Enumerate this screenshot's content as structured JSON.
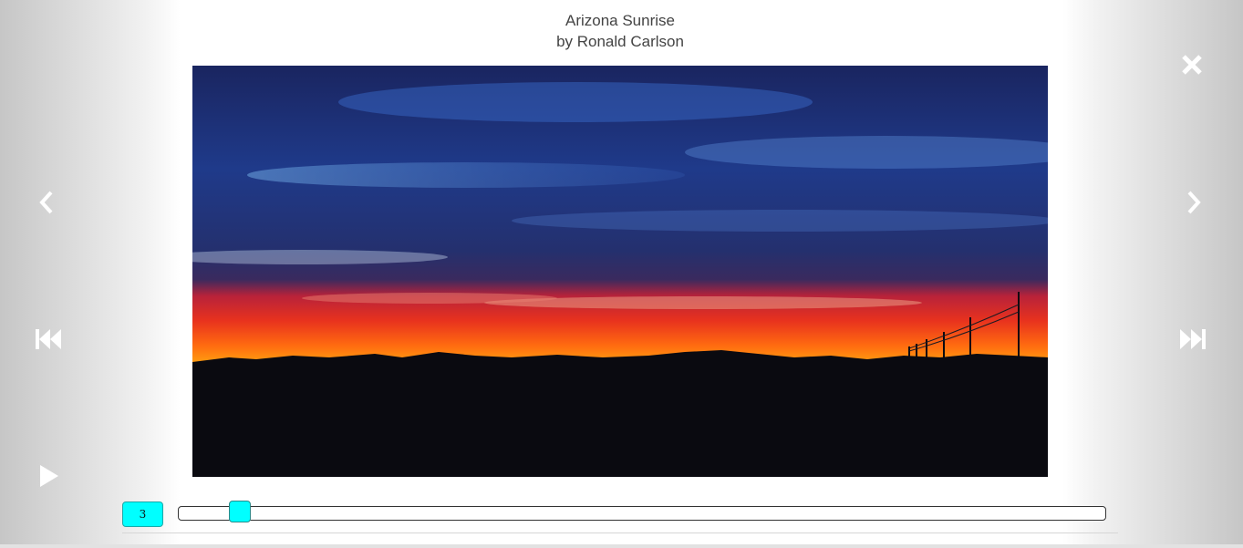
{
  "photo": {
    "title": "Arizona Sunrise",
    "byline": "by Ronald Carlson"
  },
  "icons": {
    "close": "close-icon",
    "previous": "chevron-left-icon",
    "next": "chevron-right-icon",
    "first": "skip-to-first-icon",
    "last": "skip-to-last-icon",
    "play": "play-icon"
  },
  "slider": {
    "current_index": "3",
    "position_fraction": 0.067
  },
  "colors": {
    "accent": "#00ffff",
    "icon": "#ffffff",
    "caption_text": "#444444"
  }
}
